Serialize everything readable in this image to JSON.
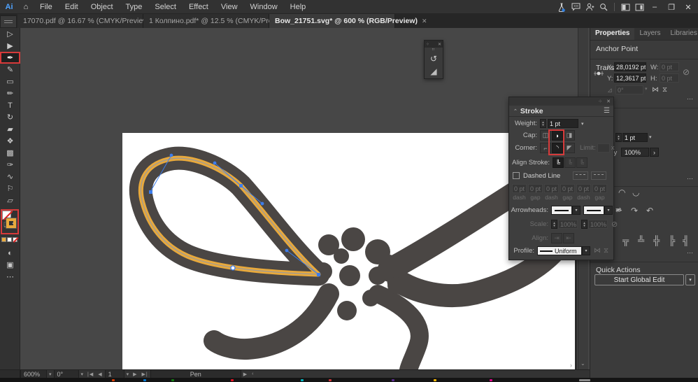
{
  "menubar": {
    "logo": "Ai",
    "items": [
      "File",
      "Edit",
      "Object",
      "Type",
      "Select",
      "Effect",
      "View",
      "Window",
      "Help"
    ]
  },
  "window_controls": {
    "minimize": "–",
    "restore": "❐",
    "close": "✕"
  },
  "tabs": [
    {
      "label": "17070.pdf @ 16.67 % (CMYK/Preview)",
      "active": false
    },
    {
      "label": "1 Колпино.pdf* @ 12.5 % (CMYK/Preview)",
      "active": false
    },
    {
      "label": "Bow_21751.svg* @ 600 % (RGB/Preview)",
      "active": true
    }
  ],
  "toolbar": {
    "tools": [
      {
        "name": "selection-tool",
        "glyph": "▷"
      },
      {
        "name": "direct-selection-tool",
        "glyph": "▶"
      },
      {
        "name": "pen-tool",
        "glyph": "✒",
        "selected": true
      },
      {
        "name": "curvature-tool",
        "glyph": "✎"
      },
      {
        "name": "rectangle-tool",
        "glyph": "▭"
      },
      {
        "name": "paintbrush-tool",
        "glyph": "✏"
      },
      {
        "name": "type-tool",
        "glyph": "T"
      },
      {
        "name": "rotate-tool",
        "glyph": "↻"
      },
      {
        "name": "eraser-tool",
        "glyph": "▰"
      },
      {
        "name": "shape-builder-tool",
        "glyph": "❖"
      },
      {
        "name": "gradient-tool",
        "glyph": "▩"
      },
      {
        "name": "eyedropper-tool",
        "glyph": "✑"
      },
      {
        "name": "blend-tool",
        "glyph": "∿"
      },
      {
        "name": "symbol-tool",
        "glyph": "⚐"
      },
      {
        "name": "artboard-tool",
        "glyph": "▱"
      },
      {
        "name": "zoom-tool",
        "glyph": "⚲"
      }
    ],
    "extra": {
      "page": "❏",
      "undo": "↰",
      "draw_mode": "◐",
      "screen_mode": "▣",
      "more": "⋯"
    }
  },
  "stroke_panel": {
    "title": "Stroke",
    "weight_label": "Weight:",
    "weight": "1 pt",
    "cap_label": "Cap:",
    "corner_label": "Corner:",
    "limit_label": "Limit:",
    "limit_suffix": "x",
    "align_stroke_label": "Align Stroke:",
    "dashed_line_label": "Dashed Line",
    "dash_fields": [
      {
        "value": "0 pt",
        "label": "dash"
      },
      {
        "value": "0 pt",
        "label": "gap"
      },
      {
        "value": "0 pt",
        "label": "dash"
      },
      {
        "value": "0 pt",
        "label": "gap"
      },
      {
        "value": "0 pt",
        "label": "dash"
      },
      {
        "value": "0 pt",
        "label": "gap"
      }
    ],
    "arrowheads_label": "Arrowheads:",
    "scale_label": "Scale:",
    "scale1": "100%",
    "scale2": "100%",
    "align_label": "Align:",
    "profile_label": "Profile:",
    "profile": "Uniform"
  },
  "properties_panel": {
    "tabs": [
      "Properties",
      "Layers",
      "Libraries"
    ],
    "anchor_point_header": "Anchor Point",
    "transform": {
      "header": "Transform",
      "x_label": "X:",
      "x": "28,0192 pt",
      "y_label": "Y:",
      "y": "12,3617 pt",
      "w_label": "W:",
      "w": "0 pt",
      "h_label": "H:",
      "h": "0 pt",
      "angle": "0°"
    },
    "appearance": {
      "stroke_weight": "1 pt",
      "opacity_label": "Opacity",
      "opacity": "100%"
    },
    "quick_actions": {
      "header": "Quick Actions",
      "button": "Start Global Edit"
    }
  },
  "status_bar": {
    "zoom": "600%",
    "rotation": "0°",
    "artboard_number": "1",
    "current_tool": "Pen"
  },
  "ui_glyphs": {
    "chevron": "▾",
    "close": "✕",
    "hamburger": "☰",
    "grip": "⠿",
    "stepper": "▴▾",
    "swap": "⇄",
    "no_link": "⊘",
    "flip_h": "⋈",
    "flip_v": "⧖",
    "angle": "⊿",
    "more": "⋯",
    "home": "⌂",
    "nav_first": "|◀",
    "nav_prev": "◀",
    "nav_next": "▶",
    "nav_last": "▶|",
    "rotate_view": "↺",
    "fin_shape": "◢",
    "corner_anchor": "◠",
    "smooth_anchor": "◡",
    "pen_nib": "✒",
    "curve_cw": "↷",
    "curve_ccw": "↶",
    "align_1": "╦",
    "align_2": "╩",
    "align_3": "╬",
    "align_4": "╠",
    "align_5": "╣"
  },
  "colors": {
    "bow_fill": "#4a4644",
    "path_yellow": "#e8a93c",
    "anchor_blue": "#3d7deb",
    "annotation_red": "#d63a3a",
    "artboard": "#ffffff",
    "pasteboard": "#474747",
    "panel_bg": "#3e3e3e"
  }
}
